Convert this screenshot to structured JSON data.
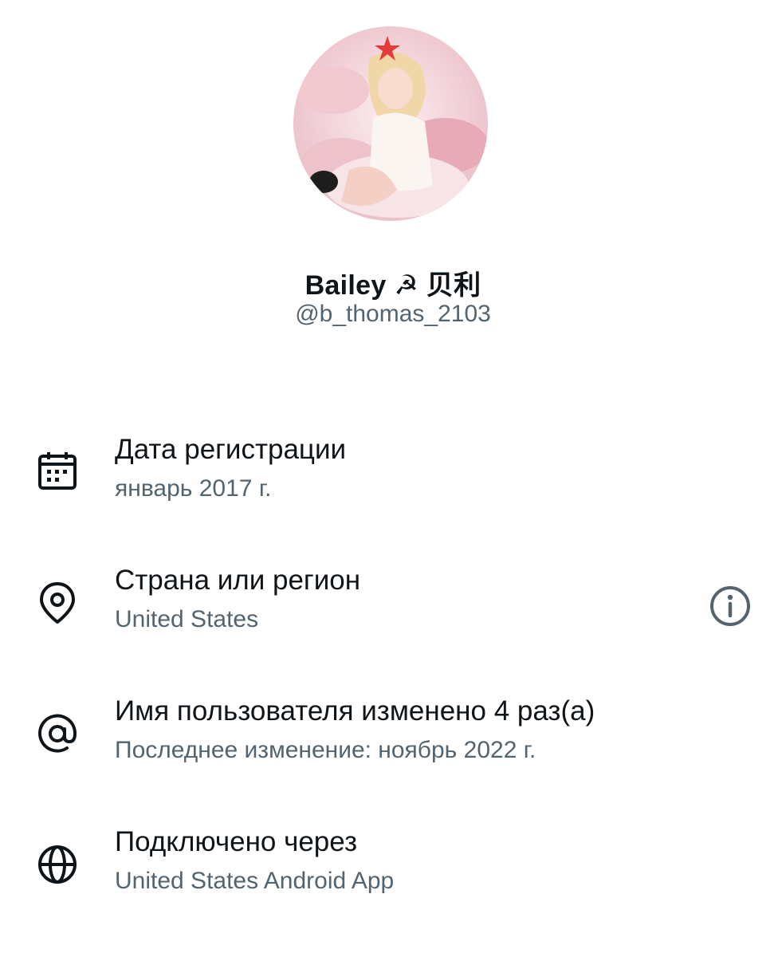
{
  "profile": {
    "display_name": "Bailey ☭ 贝利",
    "handle": "@b_thomas_2103"
  },
  "about": [
    {
      "icon": "calendar-icon",
      "title": "Дата регистрации",
      "subtitle": "январь 2017 г."
    },
    {
      "icon": "location-pin-icon",
      "title": "Страна или регион",
      "subtitle": "United States"
    },
    {
      "icon": "at-sign-icon",
      "title": "Имя пользователя изменено 4 раз(а)",
      "subtitle": "Последнее изменение: ноябрь 2022 г."
    },
    {
      "icon": "globe-icon",
      "title": "Подключено через",
      "subtitle": "United States Android App"
    }
  ],
  "colors": {
    "primary_text": "#0f1419",
    "secondary_text": "#536471",
    "background": "#ffffff"
  }
}
